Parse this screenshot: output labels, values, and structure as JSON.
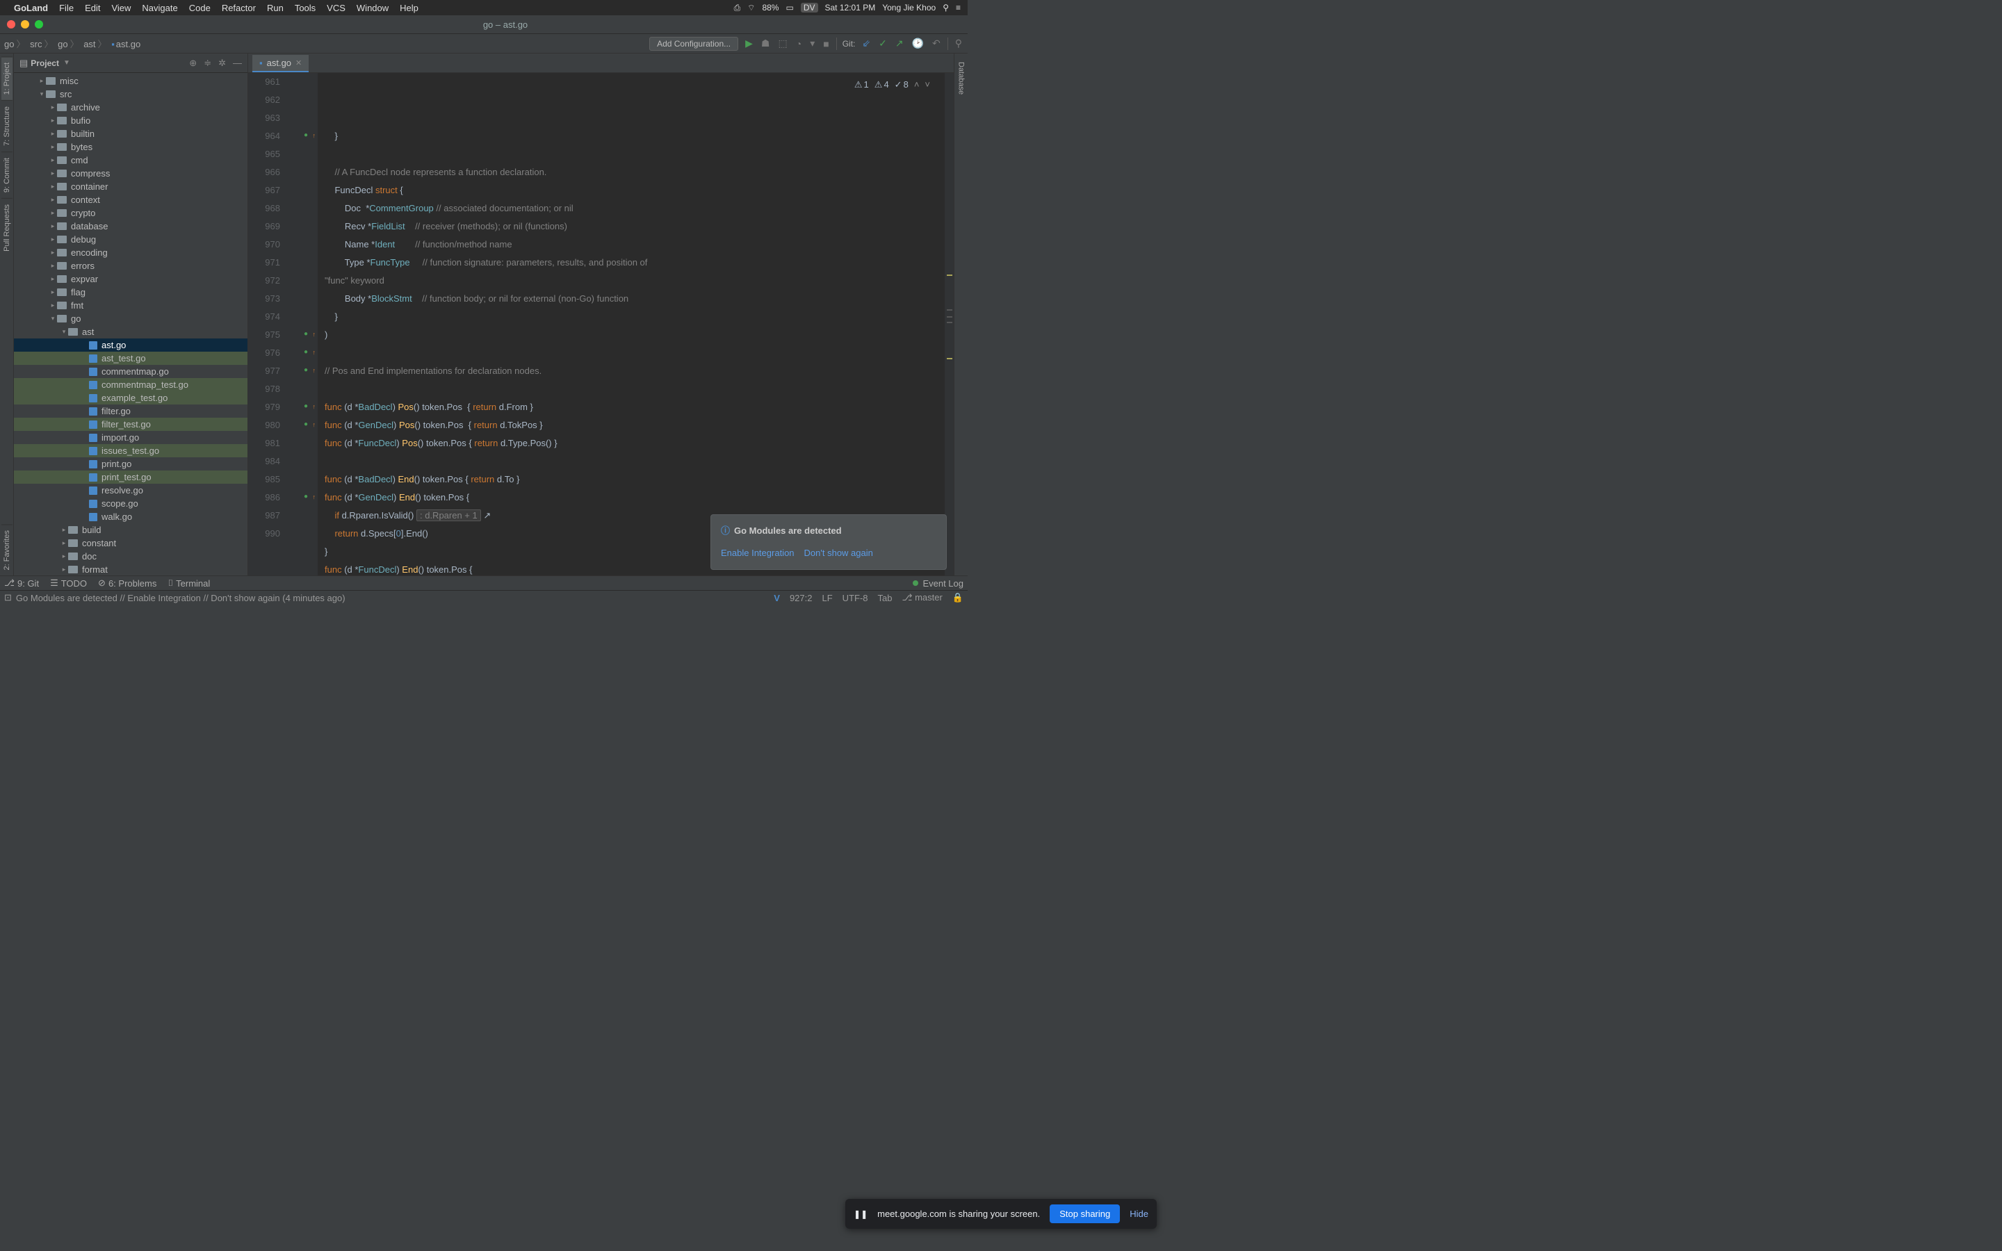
{
  "menubar": {
    "app": "GoLand",
    "items": [
      "File",
      "Edit",
      "View",
      "Navigate",
      "Code",
      "Refactor",
      "Run",
      "Tools",
      "VCS",
      "Window",
      "Help"
    ],
    "right": {
      "battery": "88%",
      "user_badge": "DV",
      "datetime": "Sat 12:01 PM",
      "username": "Yong Jie Khoo"
    }
  },
  "window_title": "go – ast.go",
  "breadcrumb": [
    "go",
    "src",
    "go",
    "ast",
    "ast.go"
  ],
  "navbar": {
    "add_config": "Add Configuration...",
    "git_label": "Git:"
  },
  "sidebar": {
    "title": "Project",
    "folders_top": [
      "misc",
      "src"
    ],
    "folders_src": [
      "archive",
      "bufio",
      "builtin",
      "bytes",
      "cmd",
      "compress",
      "container",
      "context",
      "crypto",
      "database",
      "debug",
      "encoding",
      "errors",
      "expvar",
      "flag",
      "fmt",
      "go"
    ],
    "ast_folder": "ast",
    "ast_files": [
      {
        "name": "ast.go",
        "selected": true
      },
      {
        "name": "ast_test.go",
        "vcs": true
      },
      {
        "name": "commentmap.go"
      },
      {
        "name": "commentmap_test.go",
        "vcs": true
      },
      {
        "name": "example_test.go",
        "vcs": true
      },
      {
        "name": "filter.go"
      },
      {
        "name": "filter_test.go",
        "vcs": true
      },
      {
        "name": "import.go"
      },
      {
        "name": "issues_test.go",
        "vcs": true
      },
      {
        "name": "print.go"
      },
      {
        "name": "print_test.go",
        "vcs": true
      },
      {
        "name": "resolve.go"
      },
      {
        "name": "scope.go"
      },
      {
        "name": "walk.go"
      }
    ],
    "folders_after_ast": [
      "build",
      "constant",
      "doc",
      "format"
    ]
  },
  "editor_tab": "ast.go",
  "inspections": {
    "warn": "1",
    "weak": "4",
    "ok": "8"
  },
  "code_lines": [
    961,
    962,
    963,
    964,
    965,
    966,
    967,
    968,
    969,
    970,
    971,
    972,
    973,
    974,
    975,
    976,
    977,
    978,
    979,
    980,
    981,
    984,
    985,
    986,
    987,
    990
  ],
  "code": {
    "c963": "// A FuncDecl node represents a function declaration.",
    "c965": "// associated documentation; or nil",
    "c966": "// receiver (methods); or nil (functions)",
    "c967": "// function/method name",
    "c968a": "// function signature: parameters, results, and position of",
    "c968b": "\"func\" keyword",
    "c969": "// function body; or nil for external (non-Go) function",
    "c973": "// Pos and End implementations for declaration nodes."
  },
  "left_tabs": [
    "1: Project",
    "7: Structure",
    "9: Commit",
    "Pull Requests",
    "2: Favorites"
  ],
  "right_tabs": [
    "Database"
  ],
  "bottom_tools": {
    "git": "9: Git",
    "todo": "TODO",
    "problems": "6: Problems",
    "terminal": "Terminal",
    "event_log": "Event Log"
  },
  "notification": {
    "title": "Go Modules are detected",
    "action1": "Enable Integration",
    "action2": "Don't show again"
  },
  "share_bar": {
    "text": "meet.google.com is sharing your screen.",
    "stop": "Stop sharing",
    "hide": "Hide"
  },
  "statusbar": {
    "msg": "Go Modules are detected // Enable Integration // Don't show again (4 minutes ago)",
    "pos": "927:2",
    "eol": "LF",
    "enc": "UTF-8",
    "indent": "Tab",
    "branch": "master"
  }
}
